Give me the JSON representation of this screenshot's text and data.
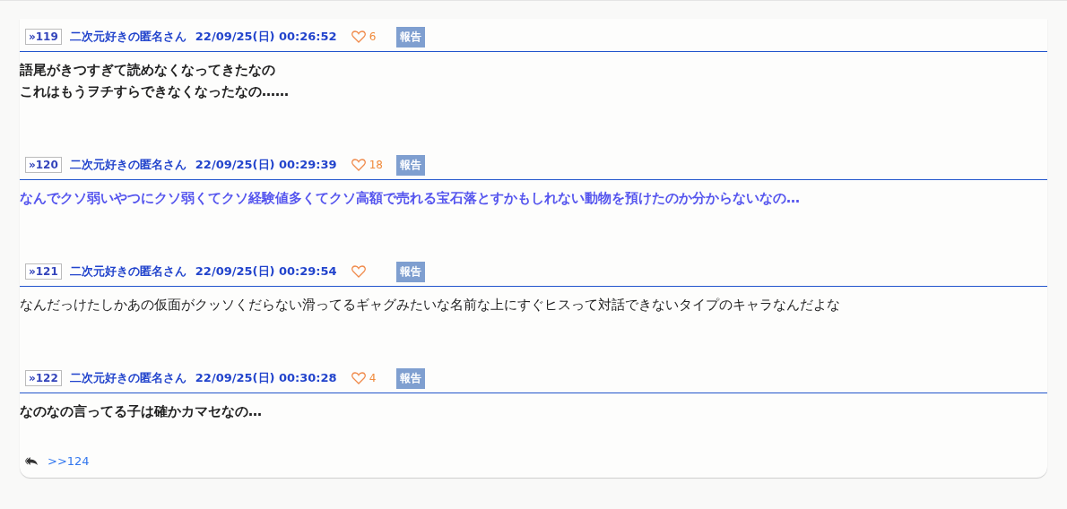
{
  "posts": [
    {
      "number": "»119",
      "author": "二次元好きの匿名さん",
      "date": "22/09/25(日) 00:26:52",
      "likes": "6",
      "report": "報告",
      "kind": "bold",
      "lines": [
        "語尾がきつすぎて読めなくなってきたなの",
        "これはもうヲチすらできなくなったなの……"
      ]
    },
    {
      "number": "»120",
      "author": "二次元好きの匿名さん",
      "date": "22/09/25(日) 00:29:39",
      "likes": "18",
      "report": "報告",
      "kind": "highlight",
      "lines": [
        "なんでクソ弱いやつにクソ弱くてクソ経験値多くてクソ高額で売れる宝石落とすかもしれない動物を預けたのか分からないなの…"
      ]
    },
    {
      "number": "»121",
      "author": "二次元好きの匿名さん",
      "date": "22/09/25(日) 00:29:54",
      "report": "報告",
      "kind": "plain",
      "lines": [
        "なんだっけたしかあの仮面がクッソくだらない滑ってるギャグみたいな名前な上にすぐヒスって対話できないタイプのキャラなんだよな"
      ]
    },
    {
      "number": "»122",
      "author": "二次元好きの匿名さん",
      "date": "22/09/25(日) 00:30:28",
      "likes": "4",
      "report": "報告",
      "kind": "bold",
      "lines": [
        "なのなの言ってる子は確かカマセなの…"
      ]
    }
  ],
  "replies": {
    "link": ">>124"
  }
}
